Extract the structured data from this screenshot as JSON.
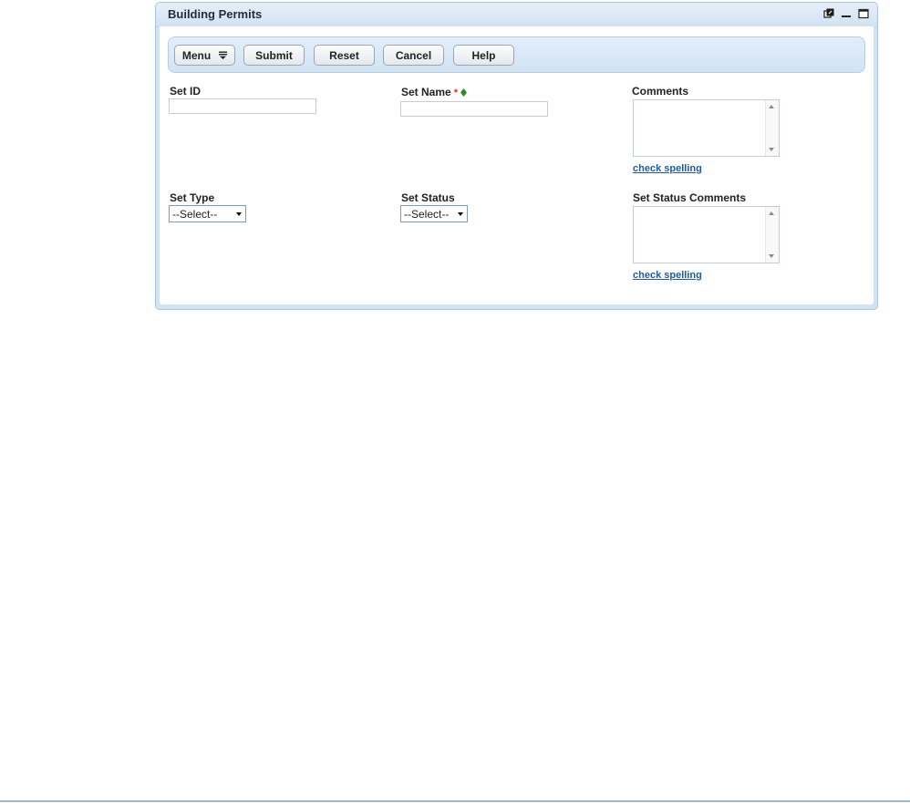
{
  "portlet": {
    "title": "Building Permits"
  },
  "toolbar": {
    "menu_label": "Menu",
    "submit_label": "Submit",
    "reset_label": "Reset",
    "cancel_label": "Cancel",
    "help_label": "Help"
  },
  "form": {
    "set_id": {
      "label": "Set ID",
      "value": ""
    },
    "set_name": {
      "label": "Set Name",
      "required_marker": "*",
      "value": ""
    },
    "comments": {
      "label": "Comments",
      "value": "",
      "spell_link": "check spelling"
    },
    "set_type": {
      "label": "Set Type",
      "selected": "--Select--"
    },
    "set_status": {
      "label": "Set Status",
      "selected": "--Select--"
    },
    "set_status_comments": {
      "label": "Set Status Comments",
      "value": "",
      "spell_link": "check spelling"
    }
  },
  "colors": {
    "accent": "#1f5c99",
    "required": "#d0342c",
    "diamond": "#2a8a2a",
    "header_bg": "#d3e3f3"
  },
  "icons": {
    "header": [
      "popout-icon",
      "minimize-icon",
      "maximize-icon"
    ],
    "field": [
      "required-asterisk",
      "diamond-icon"
    ]
  }
}
